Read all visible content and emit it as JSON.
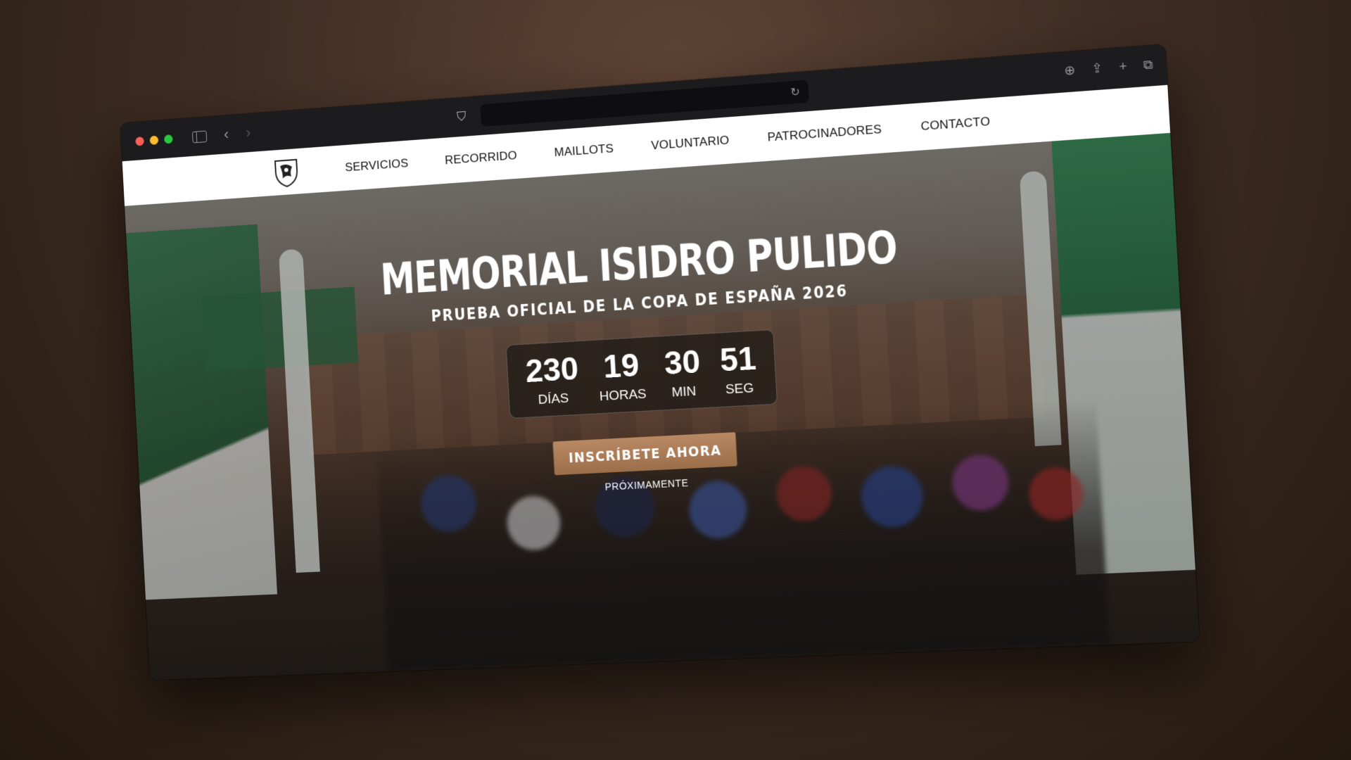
{
  "browser": {
    "url": "",
    "colors": {
      "close": "#ff5f57",
      "minimize": "#febc2e",
      "zoom": "#28c840"
    }
  },
  "nav": {
    "items": [
      "SERVICIOS",
      "RECORRIDO",
      "MAILLOTS",
      "VOLUNTARIO",
      "PATROCINADORES",
      "CONTACTO"
    ]
  },
  "hero": {
    "title": "MEMORIAL ISIDRO PULIDO",
    "subtitle": "PRUEBA OFICIAL DE LA COPA DE ESPAÑA 2026",
    "countdown": {
      "days": "230",
      "days_label": "DÍAS",
      "hours": "19",
      "hours_label": "HORAS",
      "minutes": "30",
      "minutes_label": "MIN",
      "seconds": "51",
      "seconds_label": "SEG"
    },
    "cta_label": "INSCRÍBETE AHORA",
    "cta_note": "PRÓXIMAMENTE",
    "accent_color": "#a9774f"
  }
}
